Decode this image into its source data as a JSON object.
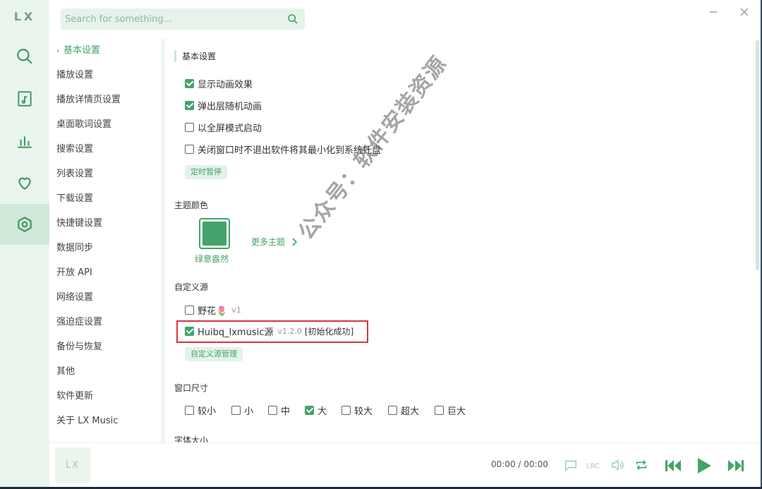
{
  "app": {
    "logo": "LX"
  },
  "search": {
    "placeholder": "Search for something..."
  },
  "rail": {
    "items": [
      "search-icon",
      "music-list-icon",
      "leaderboard-icon",
      "heart-icon",
      "settings-icon"
    ],
    "active": 4
  },
  "nav": {
    "items": [
      "基本设置",
      "播放设置",
      "播放详情页设置",
      "桌面歌词设置",
      "搜索设置",
      "列表设置",
      "下载设置",
      "快捷键设置",
      "数据同步",
      "开放 API",
      "网络设置",
      "强迫症设置",
      "备份与恢复",
      "其他",
      "软件更新",
      "关于 LX Music"
    ],
    "active": 0
  },
  "basic": {
    "title": "基本设置",
    "options": [
      {
        "label": "显示动画效果",
        "checked": true
      },
      {
        "label": "弹出层随机动画",
        "checked": true
      },
      {
        "label": "以全屏模式启动",
        "checked": false
      },
      {
        "label": "关闭窗口时不退出软件将其最小化到系统托盘",
        "checked": false
      }
    ],
    "timer_button": "定时暂停"
  },
  "theme": {
    "title": "主题颜色",
    "current": "绿意盎然",
    "more": "更多主题",
    "color": "#43a36a"
  },
  "custom_source": {
    "title": "自定义源",
    "sources": [
      {
        "name": "野花🌷",
        "version": "v1",
        "status": "",
        "checked": false
      },
      {
        "name": "Huibq_lxmusic源",
        "version": "v1.2.0",
        "status": "[初始化成功]",
        "checked": true
      }
    ],
    "manage_button": "自定义源管理"
  },
  "window_size": {
    "title": "窗口尺寸",
    "options": [
      {
        "label": "较小",
        "checked": false
      },
      {
        "label": "小",
        "checked": false
      },
      {
        "label": "中",
        "checked": false
      },
      {
        "label": "大",
        "checked": true
      },
      {
        "label": "较大",
        "checked": false
      },
      {
        "label": "超大",
        "checked": false
      },
      {
        "label": "巨大",
        "checked": false
      }
    ]
  },
  "font_size": {
    "title": "字体大小"
  },
  "watermark": "公众号：软件安装资源",
  "player": {
    "art_label": "LX",
    "time": "00:00 / 00:00"
  },
  "colors": {
    "accent": "#43a36a",
    "rail_bg": "#eaf5ee",
    "highlight": "#d9363e"
  }
}
